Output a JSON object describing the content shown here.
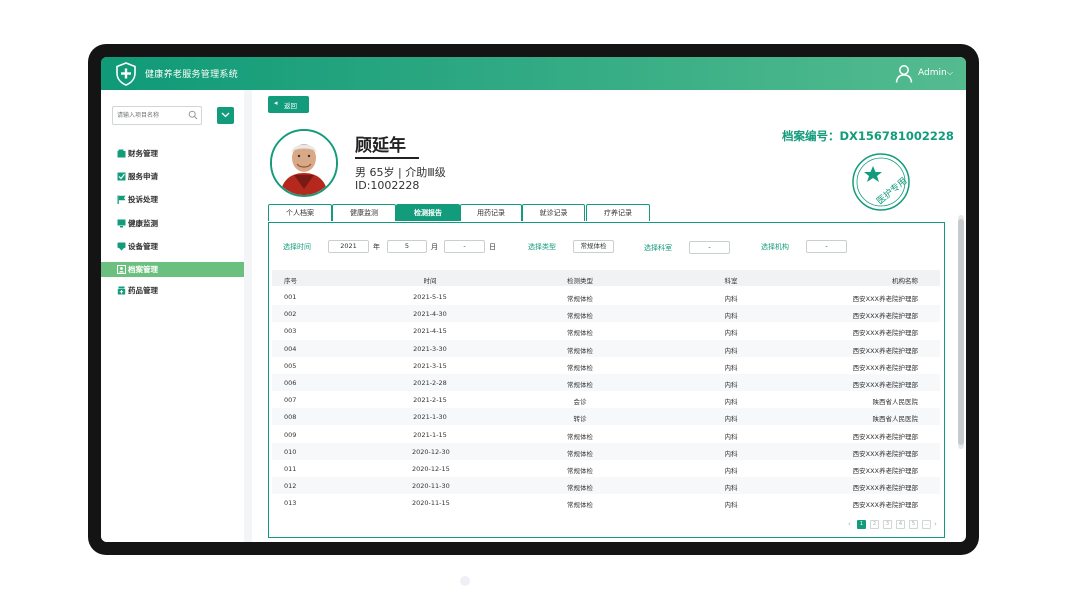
{
  "app": {
    "title": "健康养老服务管理系统",
    "user": "Admin"
  },
  "sidebar": {
    "search_placeholder": "请输入项目名称",
    "items": [
      {
        "label": "财务管理",
        "icon": "wallet-icon"
      },
      {
        "label": "服务申请",
        "icon": "checkbox-icon"
      },
      {
        "label": "投诉处理",
        "icon": "flag-icon"
      },
      {
        "label": "健康监测",
        "icon": "monitor-icon"
      },
      {
        "label": "设备管理",
        "icon": "device-icon"
      },
      {
        "label": "档案管理",
        "icon": "profile-icon"
      },
      {
        "label": "药品管理",
        "icon": "medicine-icon"
      }
    ],
    "active_index": 5
  },
  "back_label": "返回",
  "patient": {
    "name": "顾延年",
    "info": "男  65岁 | 介助Ⅲ级",
    "id": "ID:1002228",
    "record_no": "档案编号：DX156781002228",
    "stamp_text": "医护专用"
  },
  "tabs": [
    "个人档案",
    "健康监测",
    "检测报告",
    "用药记录",
    "就诊记录",
    "疗养记录"
  ],
  "active_tab": 2,
  "filters": {
    "time_label": "选择时间",
    "year": "2021",
    "year_unit": "年",
    "month": "5",
    "month_unit": "月",
    "day": "-",
    "day_unit": "日",
    "type_label": "选择类型",
    "type_value": "常规体检",
    "dept_label": "选择科室",
    "dept_value": "-",
    "org_label": "选择机构",
    "org_value": "-"
  },
  "table": {
    "columns": [
      "序号",
      "时间",
      "检测类型",
      "科室",
      "机构名称"
    ],
    "rows": [
      [
        "001",
        "2021-5-15",
        "常规体检",
        "内科",
        "西安XXX养老院护理部"
      ],
      [
        "002",
        "2021-4-30",
        "常规体检",
        "内科",
        "西安XXX养老院护理部"
      ],
      [
        "003",
        "2021-4-15",
        "常规体检",
        "内科",
        "西安XXX养老院护理部"
      ],
      [
        "004",
        "2021-3-30",
        "常规体检",
        "内科",
        "西安XXX养老院护理部"
      ],
      [
        "005",
        "2021-3-15",
        "常规体检",
        "内科",
        "西安XXX养老院护理部"
      ],
      [
        "006",
        "2021-2-28",
        "常规体检",
        "内科",
        "西安XXX养老院护理部"
      ],
      [
        "007",
        "2021-2-15",
        "会诊",
        "内科",
        "陕西省人民医院"
      ],
      [
        "008",
        "2021-1-30",
        "转诊",
        "内科",
        "陕西省人民医院"
      ],
      [
        "009",
        "2021-1-15",
        "常规体检",
        "内科",
        "西安XXX养老院护理部"
      ],
      [
        "010",
        "2020-12-30",
        "常规体检",
        "内科",
        "西安XXX养老院护理部"
      ],
      [
        "011",
        "2020-12-15",
        "常规体检",
        "内科",
        "西安XXX养老院护理部"
      ],
      [
        "012",
        "2020-11-30",
        "常规体检",
        "内科",
        "西安XXX养老院护理部"
      ],
      [
        "013",
        "2020-11-15",
        "常规体检",
        "内科",
        "西安XXX养老院护理部"
      ]
    ]
  },
  "pagination": {
    "pages": [
      "1",
      "2",
      "3",
      "4",
      "5",
      "..."
    ],
    "current": 1,
    "prev": "‹",
    "next": "›"
  },
  "colors": {
    "primary": "#139c7c",
    "active_nav": "#6cc07f",
    "header_start": "#0f9a78",
    "header_end": "#54bb8f"
  }
}
